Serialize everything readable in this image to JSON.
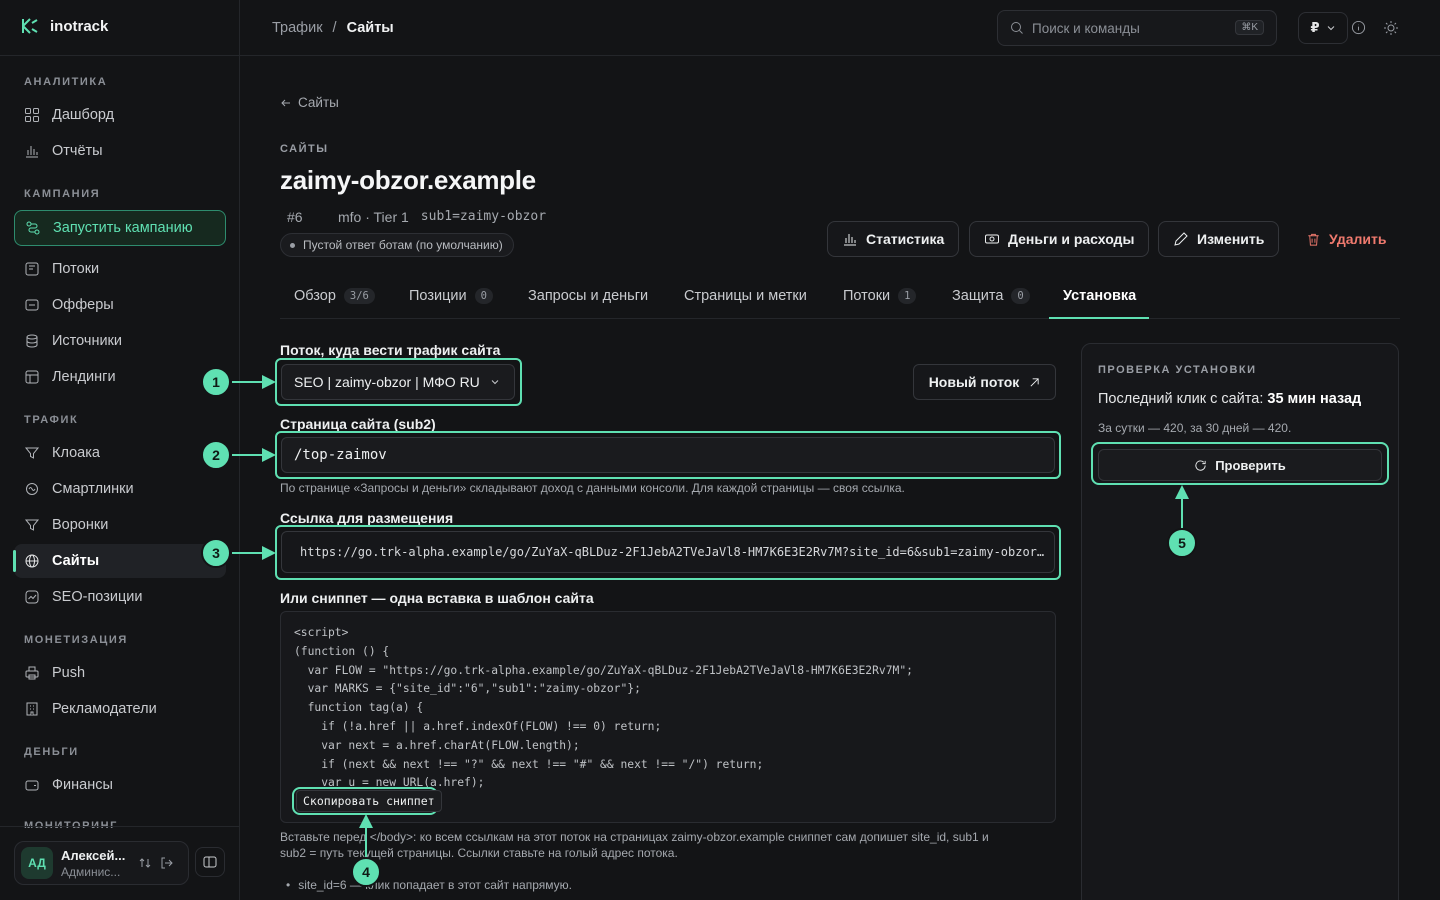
{
  "app": {
    "name": "inotrack"
  },
  "sidebar": {
    "sections": {
      "analytics": "АНАЛИТИКА",
      "campaigns": "КАМПАНИЯ",
      "traffic": "ТРАФИК",
      "monetization": "МОНЕТИЗАЦИЯ",
      "money": "ДЕНЬГИ",
      "monitoring": "МОНИТОРИНГ"
    },
    "items": {
      "dashboard": "Дашборд",
      "reports": "Отчёты",
      "launch": "Запустить кампанию",
      "flows": "Потоки",
      "offers": "Офферы",
      "sources": "Источники",
      "landings": "Лендинги",
      "cloaka": "Клоака",
      "smartlinks": "Смартлинки",
      "funnels": "Воронки",
      "sites": "Сайты",
      "seo": "SEO-позиции",
      "push": "Push",
      "advertisers": "Рекламодатели",
      "finance": "Финансы"
    },
    "user": {
      "initials": "АД",
      "name": "Алексей...",
      "role": "Админис..."
    }
  },
  "topbar": {
    "crumb_parent": "Трафик",
    "crumb_sep": "/",
    "crumb_current": "Сайты",
    "search_placeholder": "Поиск и команды",
    "search_kbd": "⌘K",
    "currency": "₽"
  },
  "page": {
    "back": "Сайты",
    "eyebrow": "САЙТЫ",
    "title": "zaimy-obzor.example",
    "id": "#6",
    "meta": "mfo · Tier 1",
    "sub1": "sub1=zaimy-obzor",
    "bot_pill": "Пустой ответ ботам (по умолчанию)",
    "buttons": {
      "stats": "Статистика",
      "money": "Деньги и расходы",
      "edit": "Изменить",
      "delete": "Удалить"
    },
    "tabs": [
      {
        "label": "Обзор",
        "count": "3/6"
      },
      {
        "label": "Позиции",
        "count": "0"
      },
      {
        "label": "Запросы и деньги",
        "count": ""
      },
      {
        "label": "Страницы и метки",
        "count": ""
      },
      {
        "label": "Потоки",
        "count": "1"
      },
      {
        "label": "Защита",
        "count": "0"
      },
      {
        "label": "Установка",
        "count": ""
      }
    ]
  },
  "install": {
    "flow_label": "Поток, куда вести трафик сайта",
    "flow_value": "SEO | zaimy-obzor | МФО RU",
    "new_flow": "Новый поток",
    "page_label": "Страница сайта (sub2)",
    "page_value": "/top-zaimov",
    "page_hint": "По странице «Запросы и деньги» складывают доход с данными консоли. Для каждой страницы — своя ссылка.",
    "link_label": "Ссылка для размещения",
    "link_value": "https://go.trk-alpha.example/go/ZuYaX-qBLDuz-2F1JebA2TVeJaVl8-HM7K6E3E2Rv7M?site_id=6&sub1=zaimy-obzor…",
    "snippet_label": "Или сниппет — одна вставка в шаблон сайта",
    "snippet_code": "<script>\n(function () {\n  var FLOW = \"https://go.trk-alpha.example/go/ZuYaX-qBLDuz-2F1JebA2TVeJaVl8-HM7K6E3E2Rv7M\";\n  var MARKS = {\"site_id\":\"6\",\"sub1\":\"zaimy-obzor\"};\n  function tag(a) {\n    if (!a.href || a.href.indexOf(FLOW) !== 0) return;\n    var next = a.href.charAt(FLOW.length);\n    if (next && next !== \"?\" && next !== \"#\" && next !== \"/\") return;\n    var u = new URL(a.href);",
    "copy_snippet": "Скопировать сниппет",
    "snippet_hint_1": "Вставьте перед </body>: ко всем ссылкам на этот поток на страницах zaimy-obzor.example сниппет сам допишет site_id, sub1 и",
    "snippet_hint_2": "sub2 = путь текущей страницы. Ссылки ставьте на голый адрес потока.",
    "bullet": "site_id=6 — клик попадает в этот сайт напрямую."
  },
  "check": {
    "eyebrow": "ПРОВЕРКА УСТАНОВКИ",
    "last_click_prefix": "Последний клик с сайта:",
    "last_click_value": "35 мин назад",
    "stats": "За сутки — 420, за 30 дней — 420.",
    "button": "Проверить"
  },
  "markers": [
    "1",
    "2",
    "3",
    "4",
    "5"
  ],
  "colors": {
    "accent": "#5fe0b2",
    "danger": "#f07a6e",
    "bg": "#131416"
  }
}
